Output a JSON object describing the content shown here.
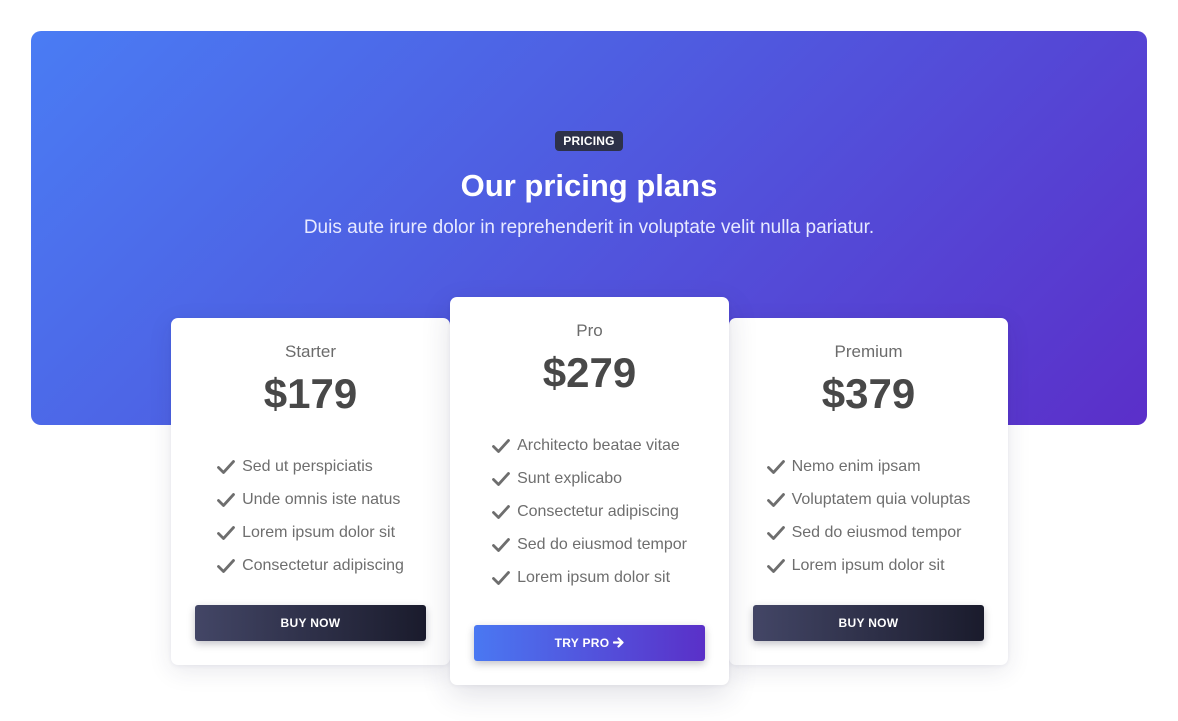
{
  "hero": {
    "badge": "PRICING",
    "title": "Our pricing plans",
    "subtitle": "Duis aute irure dolor in reprehenderit in voluptate velit nulla pariatur."
  },
  "plans": [
    {
      "name": "Starter",
      "price": "$179",
      "features": [
        "Sed ut perspiciatis",
        "Unde omnis iste natus",
        "Lorem ipsum dolor sit",
        "Consectetur adipiscing"
      ],
      "button": "BUY NOW"
    },
    {
      "name": "Pro",
      "price": "$279",
      "features": [
        "Architecto beatae vitae",
        "Sunt explicabo",
        "Consectetur adipiscing",
        "Sed do eiusmod tempor",
        "Lorem ipsum dolor sit"
      ],
      "button": "TRY PRO",
      "button_icon": "arrow-right-icon"
    },
    {
      "name": "Premium",
      "price": "$379",
      "features": [
        "Nemo enim ipsam",
        "Voluptatem quia voluptas",
        "Sed do eiusmod tempor",
        "Lorem ipsum dolor sit"
      ],
      "button": "BUY NOW"
    }
  ],
  "colors": {
    "hero_gradient_start": "#4a7cf4",
    "hero_gradient_end": "#5b2fc9",
    "badge_bg": "#2d3148",
    "dark_button_start": "#434666",
    "dark_button_end": "#1a1b2c",
    "check": "#6e6e6e"
  },
  "icons": {
    "feature": "check-icon"
  }
}
